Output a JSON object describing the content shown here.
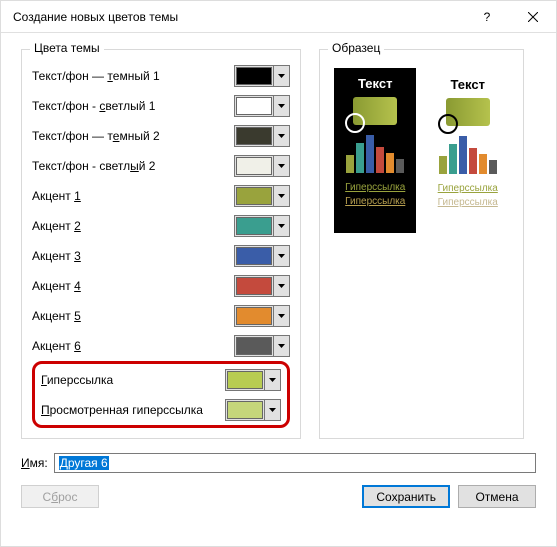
{
  "title": "Создание новых цветов темы",
  "groups": {
    "theme_colors": "Цвета темы",
    "sample": "Образец"
  },
  "rows": [
    {
      "prefix": "Текст/фон — ",
      "ul": "т",
      "suffix": "емный 1",
      "color": "#000000"
    },
    {
      "prefix": "Текст/фон - ",
      "ul": "с",
      "suffix": "ветлый 1",
      "color": "#ffffff"
    },
    {
      "prefix": "Текст/фон — т",
      "ul": "е",
      "suffix": "мный 2",
      "color": "#3a3a2e"
    },
    {
      "prefix": "Текст/фон - светл",
      "ul": "ы",
      "suffix": "й 2",
      "color": "#f0f0e8"
    },
    {
      "prefix": "Акцент ",
      "ul": "1",
      "suffix": "",
      "color": "#99a33d"
    },
    {
      "prefix": "Акцент ",
      "ul": "2",
      "suffix": "",
      "color": "#3a9e8f"
    },
    {
      "prefix": "Акцент ",
      "ul": "3",
      "suffix": "",
      "color": "#3a5da8"
    },
    {
      "prefix": "Акцент ",
      "ul": "4",
      "suffix": "",
      "color": "#c44a3d"
    },
    {
      "prefix": "Акцент ",
      "ul": "5",
      "suffix": "",
      "color": "#e28b2e"
    },
    {
      "prefix": "Акцент ",
      "ul": "6",
      "suffix": "",
      "color": "#5a5a5a"
    }
  ],
  "highlighted": [
    {
      "prefix": "",
      "ul": "Г",
      "suffix": "иперссылка",
      "color": "#b8cc52"
    },
    {
      "prefix": "",
      "ul": "П",
      "suffix": "росмотренная гиперссылка",
      "color": "#c5d67a"
    }
  ],
  "preview": {
    "text_label": "Текст",
    "hyperlink": "Гиперссылка",
    "followed": "Гиперссылка",
    "link_color": "#99a33d",
    "followed_color_dark": "#b8a050",
    "followed_color_light": "#c5b890",
    "bars": [
      {
        "h": 18,
        "c": "#99a33d"
      },
      {
        "h": 30,
        "c": "#3a9e8f"
      },
      {
        "h": 38,
        "c": "#3a5da8"
      },
      {
        "h": 26,
        "c": "#c44a3d"
      },
      {
        "h": 20,
        "c": "#e28b2e"
      },
      {
        "h": 14,
        "c": "#5a5a5a"
      }
    ]
  },
  "name_label_ul": "И",
  "name_label_suffix": "мя:",
  "name_value": "Другая 6",
  "buttons": {
    "reset_ul": "б",
    "reset_prefix": "С",
    "reset_suffix": "рос",
    "save": "Сохранить",
    "cancel": "Отмена"
  }
}
